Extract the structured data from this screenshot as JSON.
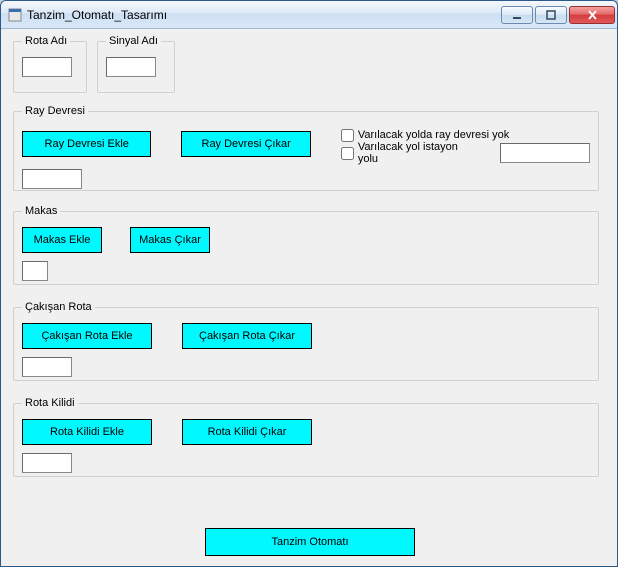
{
  "window": {
    "title": "Tanzim_Otomatı_Tasarımı"
  },
  "groups": {
    "rota_adi": {
      "legend": "Rota Adı",
      "value": ""
    },
    "sinyal_adi": {
      "legend": "Sinyal Adı",
      "value": ""
    },
    "ray": {
      "legend": "Ray Devresi",
      "add_label": "Ray Devresi Ekle",
      "remove_label": "Ray Devresi Çıkar",
      "chk_no_ray_label": "Varılacak yolda ray devresi yok",
      "chk_no_ray_checked": false,
      "chk_istasyon_label": "Varılacak yol istayon yolu",
      "chk_istasyon_checked": false,
      "yol_value": "",
      "field_value": ""
    },
    "makas": {
      "legend": "Makas",
      "add_label": "Makas Ekle",
      "remove_label": "Makas Çıkar",
      "field_value": ""
    },
    "cakisan": {
      "legend": "Çakışan Rota",
      "add_label": "Çakışan Rota Ekle",
      "remove_label": "Çakışan Rota Çıkar",
      "field_value": ""
    },
    "kilidi": {
      "legend": "Rota Kilidi",
      "add_label": "Rota Kilidi Ekle",
      "remove_label": "Rota Kilidi Çıkar",
      "field_value": ""
    }
  },
  "footer": {
    "tanzim_label": "Tanzim Otomatı"
  }
}
